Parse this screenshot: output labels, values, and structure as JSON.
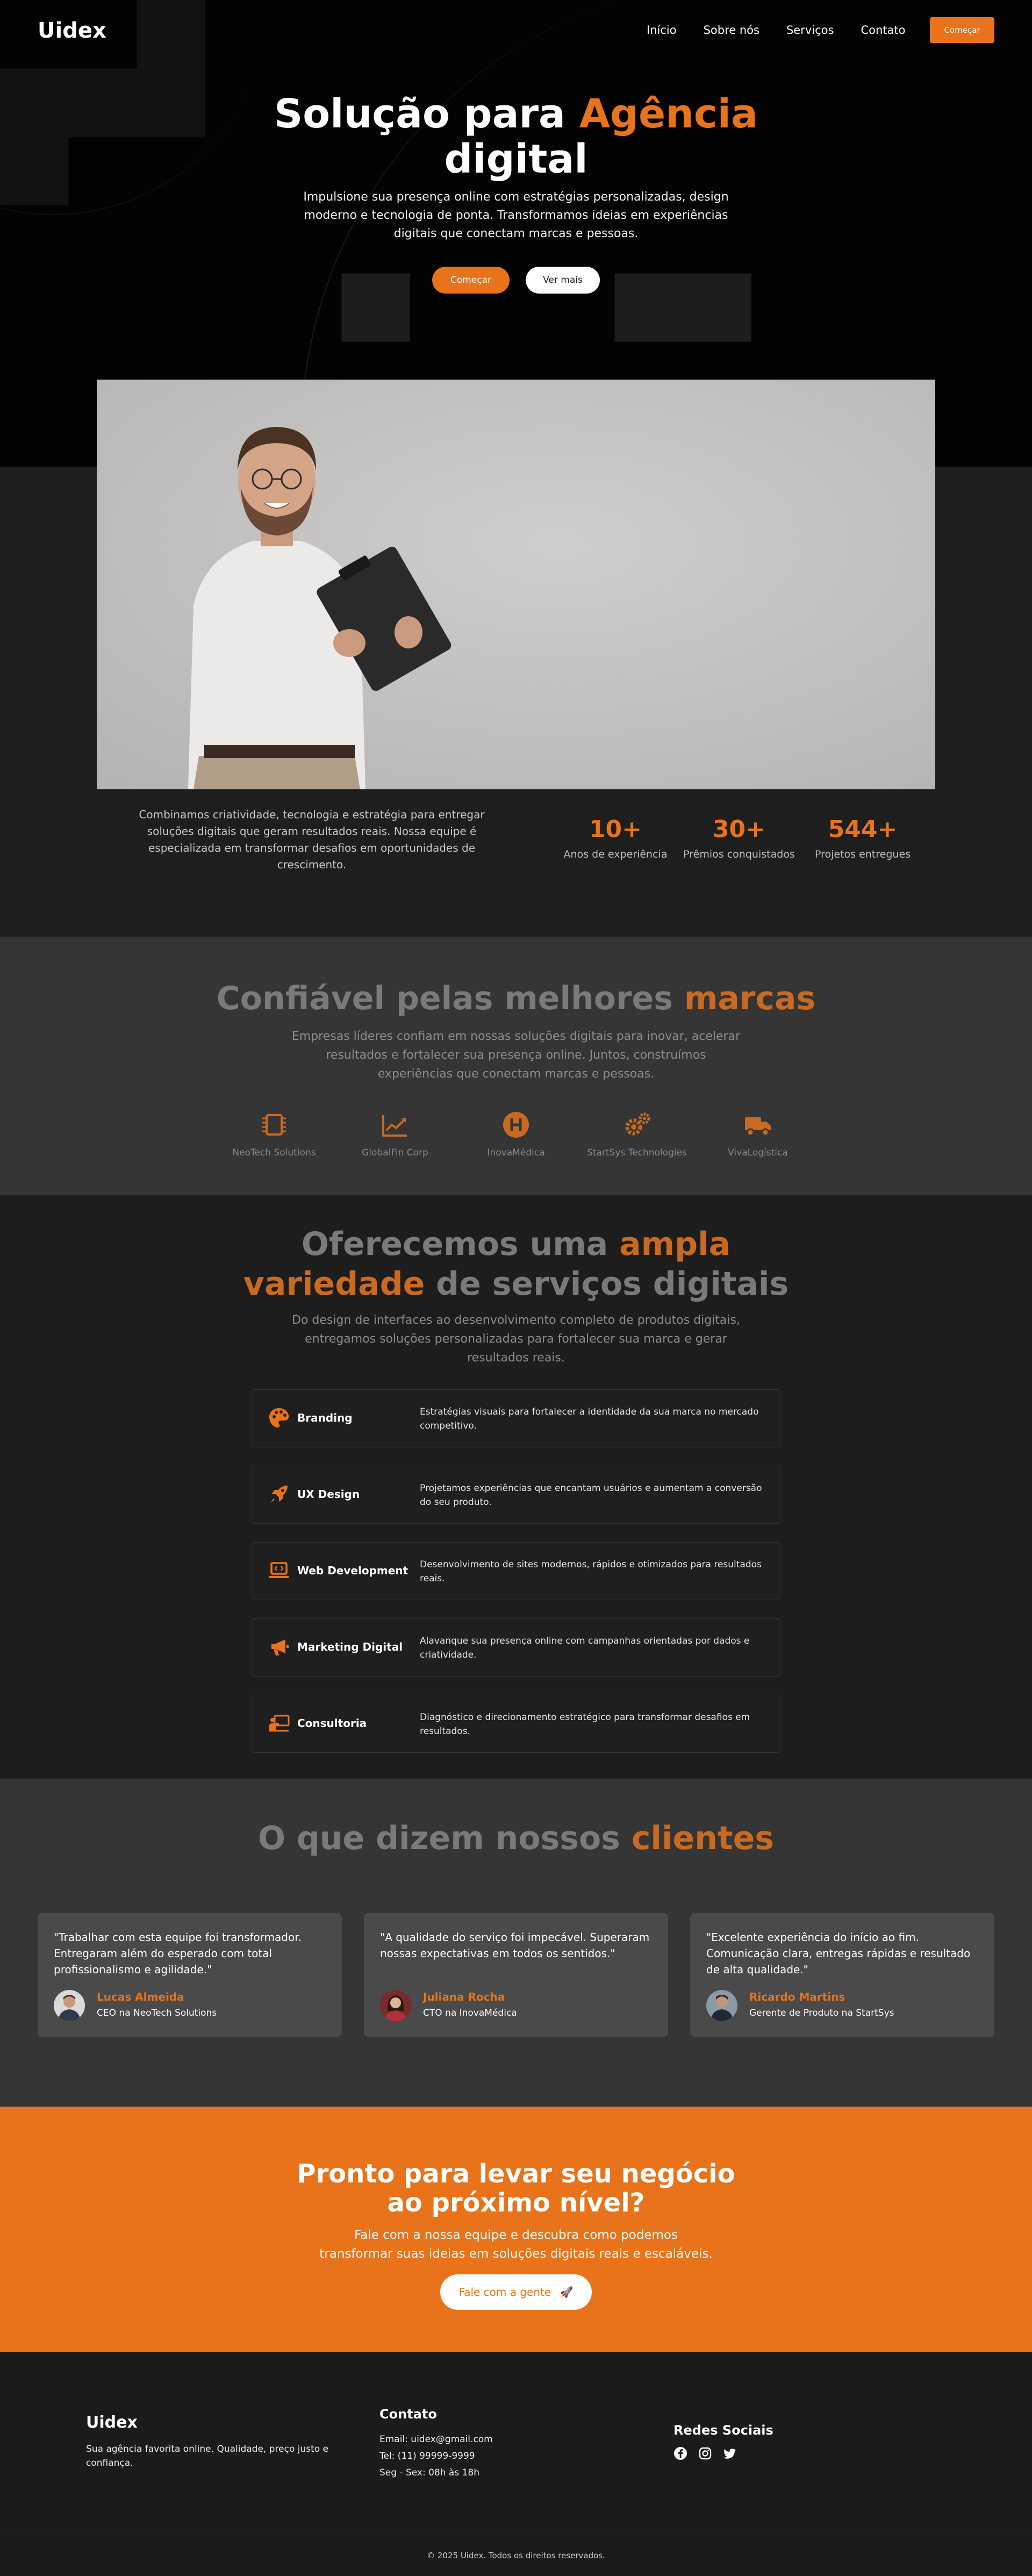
{
  "header": {
    "logo": "Uidex",
    "nav": [
      "Início",
      "Sobre nós",
      "Serviços",
      "Contato"
    ],
    "cta": "Começar"
  },
  "hero": {
    "title_part1": "Solução para",
    "title_accent": "Agência",
    "title_part2": "digital",
    "subtitle": "Impulsione sua presença online com estratégias personalizadas, design moderno e tecnologia de ponta. Transformamos ideias em experiências digitais que conectam marcas e pessoas.",
    "primary_button": "Começar",
    "secondary_button": "Ver mais"
  },
  "about": {
    "text": "Combinamos criatividade, tecnologia e estratégia para entregar soluções digitais que geram resultados reais. Nossa equipe é especializada em transformar desafios em oportunidades de crescimento.",
    "stats": [
      {
        "value": "10+",
        "label": "Anos de experiência"
      },
      {
        "value": "30+",
        "label": "Prêmios conquistados"
      },
      {
        "value": "544+",
        "label": "Projetos entregues"
      }
    ]
  },
  "brands": {
    "title_part1": "Confiável pelas melhores",
    "title_accent": "marcas",
    "subtitle": "Empresas líderes confiam em nossas soluções digitais para inovar, acelerar resultados e fortalecer sua presença online. Juntos, construímos experiências que conectam marcas e pessoas.",
    "items": [
      {
        "name": "NeoTech Solutions",
        "icon": "chip-icon"
      },
      {
        "name": "GlobalFin Corp",
        "icon": "chart-line-icon"
      },
      {
        "name": "InovaMédica",
        "icon": "hospital-icon"
      },
      {
        "name": "StartSys Technologies",
        "icon": "gears-icon"
      },
      {
        "name": "VivaLogística",
        "icon": "truck-icon"
      }
    ]
  },
  "services": {
    "title_part1": "Oferecemos uma",
    "title_accent1": "ampla",
    "title_accent2": "variedade",
    "title_part2": "de serviços digitais",
    "subtitle": "Do design de interfaces ao desenvolvimento completo de produtos digitais, entregamos soluções personalizadas para fortalecer sua marca e gerar resultados reais.",
    "items": [
      {
        "name": "Branding",
        "desc": "Estratégias visuais para fortalecer a identidade da sua marca no mercado competitivo.",
        "icon": "palette-icon"
      },
      {
        "name": "UX Design",
        "desc": "Projetamos experiências que encantam usuários e aumentam a conversão do seu produto.",
        "icon": "rocket-icon"
      },
      {
        "name": "Web Development",
        "desc": "Desenvolvimento de sites modernos, rápidos e otimizados para resultados reais.",
        "icon": "laptop-code-icon"
      },
      {
        "name": "Marketing Digital",
        "desc": "Alavanque sua presença online com campanhas orientadas por dados e criatividade.",
        "icon": "megaphone-icon"
      },
      {
        "name": "Consultoria",
        "desc": "Diagnóstico e direcionamento estratégico para transformar desafios em resultados.",
        "icon": "presentation-icon"
      }
    ]
  },
  "testimonials": {
    "title_part1": "O que dizem nossos",
    "title_accent": "clientes",
    "items": [
      {
        "quote": "\"Trabalhar com esta equipe foi transformador. Entregaram além do esperado com total profissionalismo e agilidade.\"",
        "name": "Lucas Almeida",
        "role": "CEO na NeoTech Solutions"
      },
      {
        "quote": "\"A qualidade do serviço foi impecável. Superaram nossas expectativas em todos os sentidos.\"",
        "name": "Juliana Rocha",
        "role": "CTO na InovaMédica"
      },
      {
        "quote": "\"Excelente experiência do início ao fim. Comunicação clara, entregas rápidas e resultado de alta qualidade.\"",
        "name": "Ricardo Martins",
        "role": "Gerente de Produto na StartSys"
      }
    ]
  },
  "cta": {
    "title": "Pronto para levar seu negócio ao próximo nível?",
    "subtitle": "Fale com a nossa equipe e descubra como podemos transformar suas ideias em soluções digitais reais e escaláveis.",
    "button": "Fale com a gente",
    "button_icon": "🚀"
  },
  "footer": {
    "logo": "Uidex",
    "tagline": "Sua agência favorita online. Qualidade, preço justo e confiança.",
    "contact_title": "Contato",
    "email": "Email: uidex@gmail.com",
    "phone": "Tel: (11) 99999-9999",
    "hours": "Seg - Sex: 08h às 18h",
    "social_title": "Redes Sociais",
    "copyright": "© 2025 Uidex. Todos os direitos reservados."
  },
  "colors": {
    "accent": "#e8731a",
    "dark": "#1d1d1d",
    "mid": "#353535",
    "card": "#4a4a4a"
  }
}
